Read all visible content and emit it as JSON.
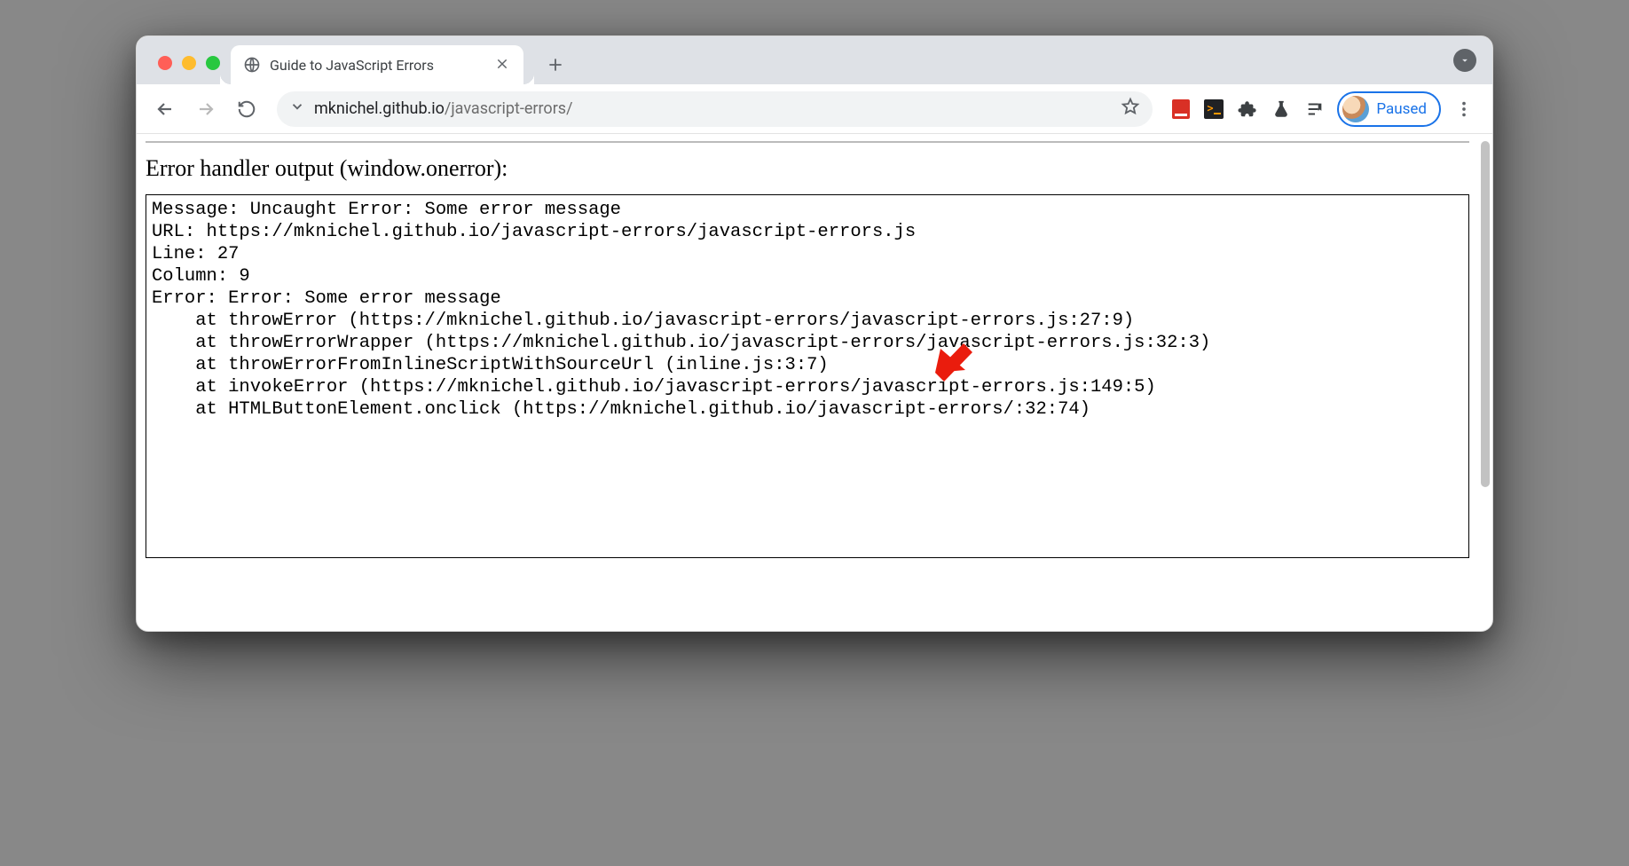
{
  "tab": {
    "title": "Guide to JavaScript Errors"
  },
  "url": {
    "host": "mknichel.github.io",
    "path": "/javascript-errors/"
  },
  "profile": {
    "status": "Paused"
  },
  "page": {
    "heading": "Error handler output (window.onerror):",
    "message_label": "Message: ",
    "message": "Uncaught Error: Some error message",
    "url_label": "URL: ",
    "url_value": "https://mknichel.github.io/javascript-errors/javascript-errors.js",
    "line_label": "Line: ",
    "line_value": "27",
    "column_label": "Column: ",
    "column_value": "9",
    "error_label": "Error: ",
    "error_value": "Error: Some error message",
    "stack": [
      "    at throwError (https://mknichel.github.io/javascript-errors/javascript-errors.js:27:9)",
      "    at throwErrorWrapper (https://mknichel.github.io/javascript-errors/javascript-errors.js:32:3)",
      "    at throwErrorFromInlineScriptWithSourceUrl (inline.js:3:7)",
      "    at invokeError (https://mknichel.github.io/javascript-errors/javascript-errors.js:149:5)",
      "    at HTMLButtonElement.onclick (https://mknichel.github.io/javascript-errors/:32:74)"
    ]
  }
}
